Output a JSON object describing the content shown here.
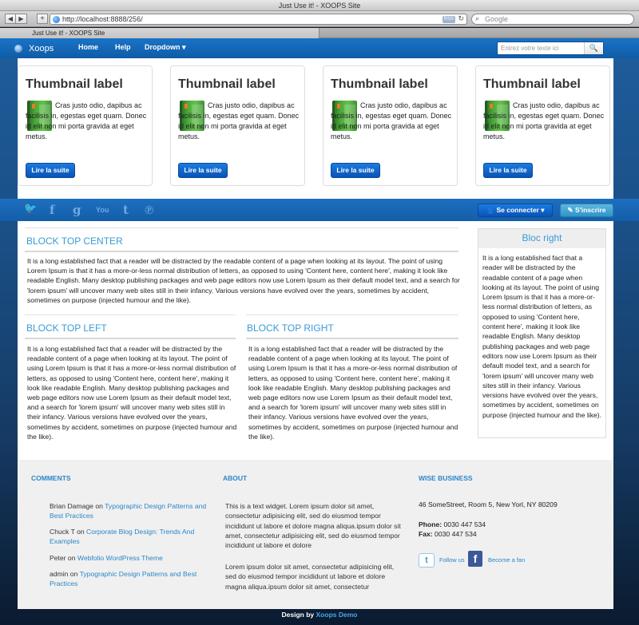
{
  "window": {
    "title": "Just Use it! - XOOPS Site",
    "url": "http://localhost:8888/256/",
    "rss_badge": "RSS",
    "search_placeholder": "Google",
    "tab_label": "Just Use it! - XOOPS Site"
  },
  "navbar": {
    "brand": "Xoops",
    "links": [
      "Home",
      "Help",
      "Dropdown ▾"
    ],
    "search_placeholder": "Entrez votre texte ici"
  },
  "thumbnails": [
    {
      "title": "Thumbnail label",
      "text": "Cras justo odio, dapibus ac facilisis in, egestas eget quam. Donec id elit non mi porta gravida at eget metus.",
      "button": "Lire la suite"
    },
    {
      "title": "Thumbnail label",
      "text": "Cras justo odio, dapibus ac facilisis in, egestas eget quam. Donec id elit non mi porta gravida at eget metus.",
      "button": "Lire la suite"
    },
    {
      "title": "Thumbnail label",
      "text": "Cras justo odio, dapibus ac facilisis in, egestas eget quam. Donec id elit non mi porta gravida at eget metus.",
      "button": "Lire la suite"
    },
    {
      "title": "Thumbnail label",
      "text": "Cras justo odio, dapibus ac facilisis in, egestas eget quam. Donec id elit non mi porta gravida at eget metus.",
      "button": "Lire la suite"
    }
  ],
  "social": {
    "icons": [
      "twitter-icon",
      "facebook-icon",
      "google-plus-icon",
      "youtube-icon",
      "tumblr-icon",
      "pinterest-icon"
    ],
    "glyphs": [
      "🐦",
      "f",
      "g",
      "You",
      "t",
      "℗"
    ],
    "connect": "Se connecter ▾",
    "signup": "S'inscrire"
  },
  "blocks": {
    "top_center": {
      "title": "BLOCK TOP CENTER",
      "text": "It is a long established fact that a reader will be distracted by the readable content of a page when looking at its layout. The point of using Lorem Ipsum is that it has a more-or-less normal distribution of letters, as opposed to using 'Content here, content here', making it look like readable English. Many desktop publishing packages and web page editors now use Lorem Ipsum as their default model text, and a search for 'lorem ipsum' will uncover many web sites still in their infancy. Various versions have evolved over the years, sometimes by accident, sometimes on purpose (injected humour and the like)."
    },
    "top_left": {
      "title": "BLOCK TOP LEFT",
      "text": "It is a long established fact that a reader will be distracted by the readable content of a page when looking at its layout. The point of using Lorem Ipsum is that it has a more-or-less normal distribution of letters, as opposed to using 'Content here, content here', making it look like readable English. Many desktop publishing packages and web page editors now use Lorem Ipsum as their default model text, and a search for 'lorem ipsum' will uncover many web sites still in their infancy. Various versions have evolved over the years, sometimes by accident, sometimes on purpose (injected humour and the like)."
    },
    "top_right": {
      "title": "BLOCK TOP RIGHT",
      "text": "It is a long established fact that a reader will be distracted by the readable content of a page when looking at its layout. The point of using Lorem Ipsum is that it has a more-or-less normal distribution of letters, as opposed to using 'Content here, content here', making it look like readable English. Many desktop publishing packages and web page editors now use Lorem Ipsum as their default model text, and a search for 'lorem ipsum' will uncover many web sites still in their infancy. Various versions have evolved over the years, sometimes by accident, sometimes on purpose (injected humour and the like)."
    },
    "right": {
      "title": "Bloc right",
      "text": "It is a long established fact that a reader will be distracted by the readable content of a page when looking at its layout. The point of using Lorem Ipsum is that it has a more-or-less normal distribution of letters, as opposed to using 'Content here, content here', making it look like readable English. Many desktop publishing packages and web page editors now use Lorem Ipsum as their default model text, and a search for 'lorem ipsum' will uncover many web sites still in their infancy. Various versions have evolved over the years, sometimes by accident, sometimes on purpose (injected humour and the like)."
    }
  },
  "footer": {
    "comments_title": "COMMENTS",
    "comments": [
      {
        "author": "Brian Damage",
        "on": " on ",
        "link": "Typographic Design Patterns and Best Practices"
      },
      {
        "author": "Chuck T",
        "on": " on ",
        "link": "Corporate Blog Design: Trends And Examples"
      },
      {
        "author": "Peter",
        "on": " on ",
        "link": "Webfolio WordPress Theme"
      },
      {
        "author": "admin",
        "on": " on ",
        "link": "Typographic Design Patterns and Best Practices"
      }
    ],
    "about_title": "ABOUT",
    "about_p1": "This is a text widget. Lorem ipsum dolor sit amet, consectetur adipisicing elit, sed do eiusmod tempor incididunt ut labore et dolore magna aliqua.ipsum dolor sit amet, consectetur adipisicing elit, sed do eiusmod tempor incididunt ut labore et dolore",
    "about_p2": "Lorem ipsum dolor sit amet, consectetur adipisicing elit, sed do eiusmod tempor incididunt ut labore et dolore magna aliqua.ipsum dolor sit amet, consectetur",
    "business_title": "WISE BUSINESS",
    "address": "46 SomeStreet, Room 5, New Yorl, NY 80209",
    "phone_label": "Phone:",
    "phone": " 0030 447 534",
    "fax_label": "Fax:",
    "fax": " 0030 447 534",
    "twitter_glyph": "t",
    "facebook_glyph": "f",
    "follow_us": "Follow us",
    "become_fan": "Become a fan"
  },
  "credits": {
    "prefix": "Design by ",
    "link": "Xoops Demo"
  },
  "colors": {
    "accent": "#3a9ad9",
    "navbar": "#1467b6",
    "button": "#0b5fc7"
  }
}
